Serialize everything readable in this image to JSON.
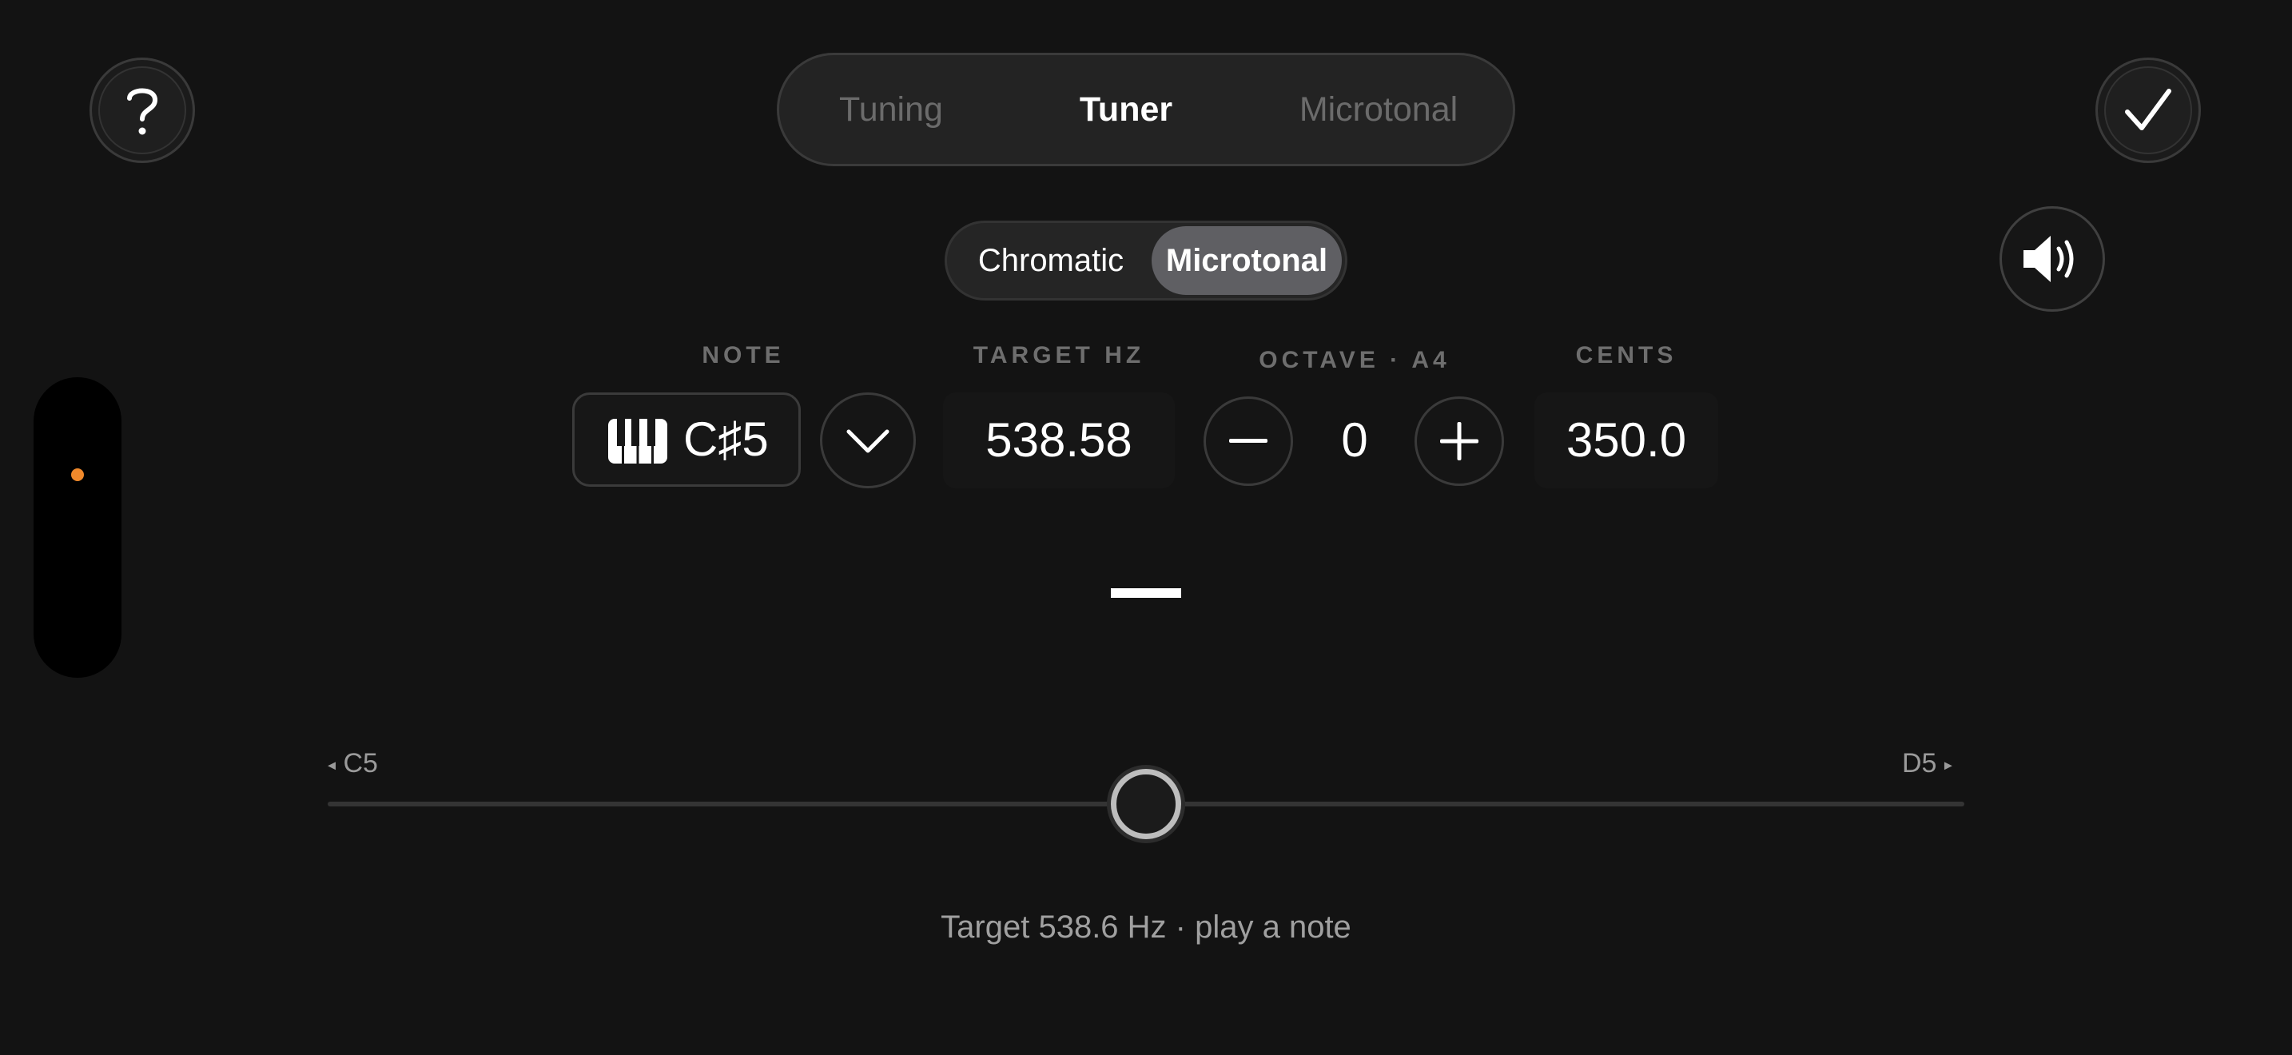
{
  "top_tabs": [
    {
      "label": "Tuning",
      "active": false
    },
    {
      "label": "Tuner",
      "active": true
    },
    {
      "label": "Microtonal",
      "active": false
    }
  ],
  "mode_toggle": {
    "options": [
      {
        "label": "Chromatic",
        "active": false
      },
      {
        "label": "Microtonal",
        "active": true
      }
    ]
  },
  "fields": {
    "note": {
      "label": "NOTE",
      "value": "C♯5"
    },
    "target_hz": {
      "label": "TARGET HZ",
      "value": "538.58"
    },
    "octave": {
      "label": "OCTAVE · A4",
      "value": "0"
    },
    "cents": {
      "label": "CENTS",
      "value": "350.0"
    }
  },
  "slider": {
    "left_label": "C5",
    "right_label": "D5",
    "position_fraction": 0.5
  },
  "status_text": "Target 538.6 Hz · play a note",
  "icons": {
    "help": "question-mark-icon",
    "confirm": "checkmark-icon",
    "sound": "speaker-icon",
    "piano": "piano-keys-icon",
    "dropdown": "chevron-down-icon"
  },
  "colors": {
    "background": "#131313",
    "accent_dot": "#f0892b",
    "active_segment": "#5f5f63",
    "inactive_text": "#6b6b6b"
  }
}
